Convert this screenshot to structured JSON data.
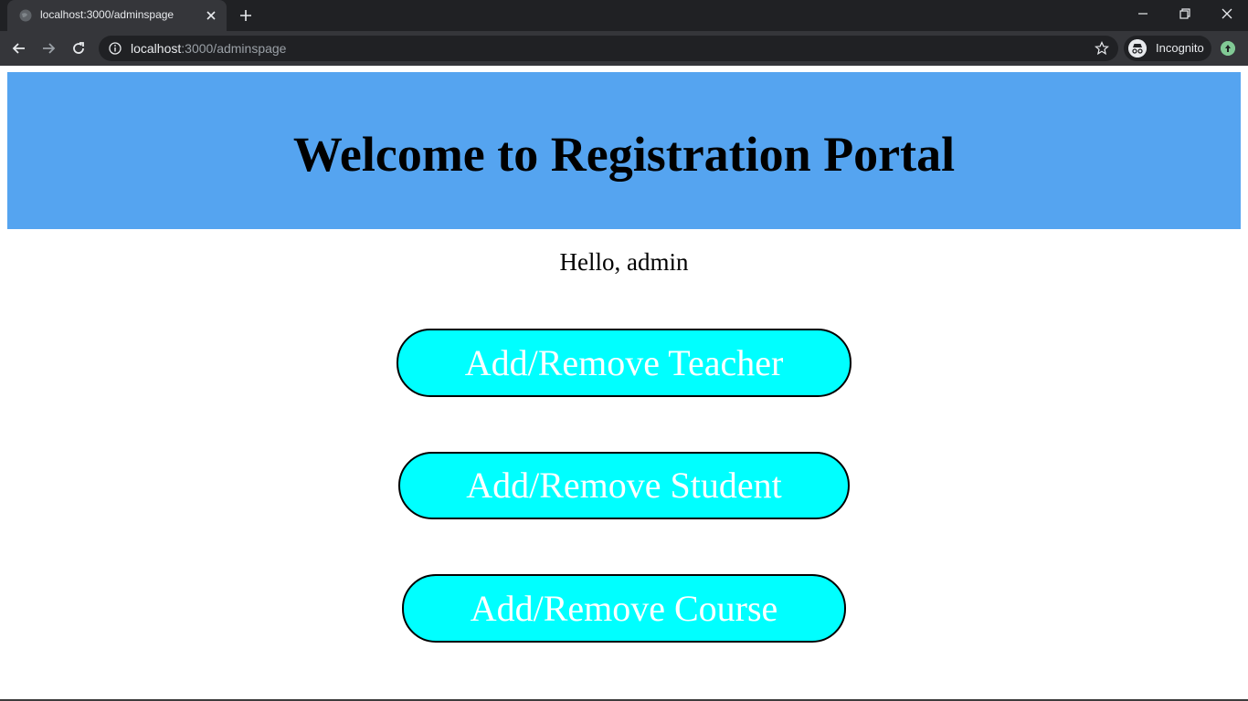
{
  "browser": {
    "tab_title": "localhost:3000/adminspage",
    "url_host": "localhost",
    "url_rest": ":3000/adminspage",
    "profile_label": "Incognito",
    "icons": {
      "favicon": "globe-icon",
      "close": "close-icon",
      "new_tab": "plus-icon",
      "back": "arrow-left-icon",
      "forward": "arrow-right-icon",
      "reload": "reload-icon",
      "info": "info-icon",
      "bookmark": "star-icon",
      "incognito": "incognito-icon",
      "extension": "extension-icon"
    }
  },
  "page": {
    "banner_title": "Welcome to Registration Portal",
    "greeting": "Hello, admin",
    "buttons": {
      "teacher": "Add/Remove Teacher",
      "student": "Add/Remove Student",
      "course": "Add/Remove Course"
    }
  },
  "colors": {
    "banner": "#55a4f0",
    "button_fill": "#00ffff",
    "button_text": "#ffffff",
    "chrome_dark": "#202124",
    "chrome_toolbar": "#35363a"
  }
}
